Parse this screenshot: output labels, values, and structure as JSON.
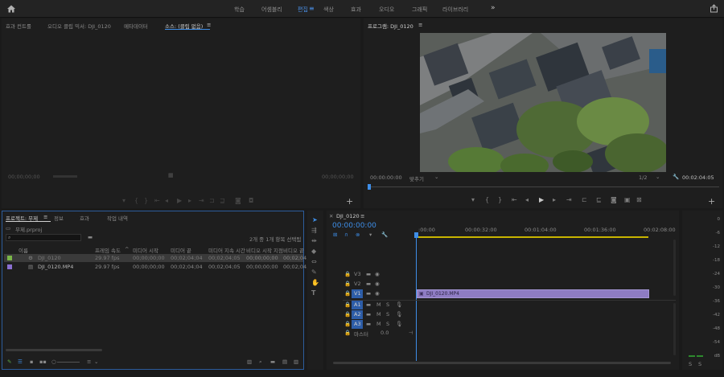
{
  "workspaces": [
    "학습",
    "어셈블리",
    "편집",
    "색상",
    "효과",
    "오디오",
    "그래픽",
    "라이브러리"
  ],
  "workspaces_more": "»",
  "source_panel": {
    "tabs": [
      "효과 컨트롤",
      "오디오 클립 믹서: DJI_0120",
      "메타데이터",
      "소스: (클립 없음)"
    ],
    "tab_menu": "≡",
    "timecode_left": "00;00;00;00",
    "timecode_right": "00;00;00;00"
  },
  "program_panel": {
    "title": "프로그램: DJI_0120",
    "title_menu": "≡",
    "timecode": "00:00:00:00",
    "fit_label": "맞추기",
    "resolution": "1/2",
    "duration": "00:02:04:05"
  },
  "project_panel": {
    "tabs": [
      "프로젝트: 무제",
      "정보",
      "효과",
      "작업 내역"
    ],
    "tab_menu": "≡",
    "project_file": "무제.prproj",
    "selection_info": "2개 중 1개 항목 선택됨",
    "columns": [
      "이름",
      "프레임 속도",
      "미디어 시작",
      "미디어 끝",
      "미디어 지속 시간",
      "비디오 시작 지점",
      "비디오 끝"
    ],
    "rows": [
      {
        "name": "DJI_0120",
        "fps": "29.97 fps",
        "start": "00;00;00;00",
        "end": "00;02;04;04",
        "duration": "00;02;04;05",
        "vstart": "00;00;00;00",
        "vend": "00;02;04;0",
        "color": "#7ab648",
        "selected": true
      },
      {
        "name": "DJI_0120.MP4",
        "fps": "29.97 fps",
        "start": "00;00;00;00",
        "end": "00;02;04;04",
        "duration": "00;02;04;05",
        "vstart": "00;00;00;00",
        "vend": "00;02;04;0",
        "color": "#8a6fd0",
        "selected": false
      }
    ]
  },
  "timeline": {
    "tab": "DJI_0120",
    "tab_menu": "≡",
    "timecode": "00:00:00:00",
    "ruler": [
      ":00:00",
      "00:00:32:00",
      "00:01:04:00",
      "00:01:36:00",
      "00:02:08:00"
    ],
    "video_tracks": [
      "V3",
      "V2",
      "V1"
    ],
    "audio_tracks": [
      "A1",
      "A2",
      "A3"
    ],
    "master_label": "마스터",
    "master_value": "0.0",
    "clip_label": "DJI_0120.MP4",
    "audio_buttons": [
      "M",
      "S"
    ]
  },
  "meter": {
    "ticks": [
      "0",
      "-6",
      "-12",
      "-18",
      "-24",
      "-30",
      "-36",
      "-42",
      "-48",
      "-54",
      "dB"
    ],
    "bottom": [
      "S",
      "S"
    ]
  },
  "colors": {
    "accent": "#3e8ee8",
    "clip": "#8e7cc3",
    "work_area": "#c8b400",
    "track_active": "#2d5da8"
  }
}
